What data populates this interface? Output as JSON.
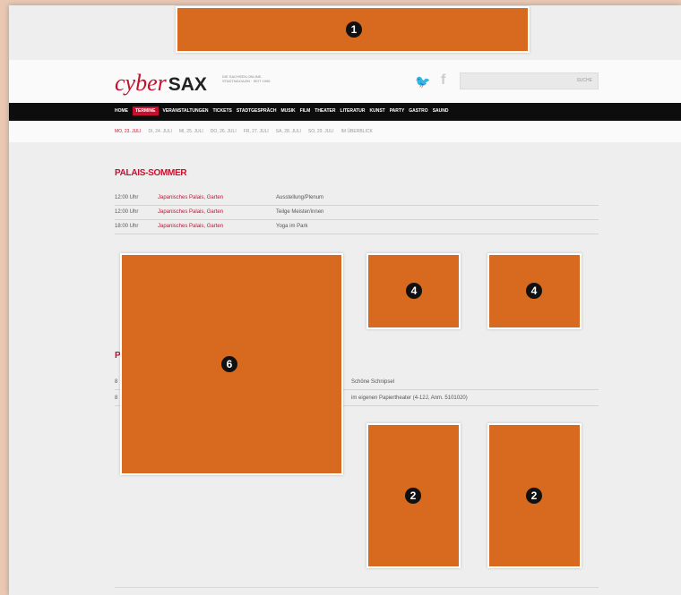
{
  "header": {
    "logo_script": "cyber",
    "logo_bold": "SAX",
    "tagline": "DIE SACHSEN-ONLINE-STADTMAGAZIN · SEIT 1996",
    "social_twitter_icon": "twitter-icon",
    "social_facebook_icon": "facebook-icon",
    "search_placeholder": "",
    "search_button": "SUCHE"
  },
  "nav_main": {
    "items": [
      "HOME",
      "TERMINE",
      "VERANSTALTUNGEN",
      "TICKETS",
      "STADTGESPRÄCH",
      "MUSIK",
      "FILM",
      "THEATER",
      "LITERATUR",
      "KUNST",
      "PARTY",
      "GASTRO",
      "SAUND"
    ],
    "active_index": 1
  },
  "nav_sub": {
    "items": [
      "MO, 23. JULI",
      "DI, 24. JULI",
      "MI, 25. JULI",
      "DO, 26. JULI",
      "FR, 27. JULI",
      "SA, 28. JULI",
      "SO, 29. JULI",
      "IM ÜBERBLICK"
    ],
    "active_index": 0
  },
  "section1": {
    "title": "PALAIS-SOMMER",
    "events": [
      {
        "time": "12:00 Uhr",
        "venue": "Japanisches Palais, Garten",
        "event": "Ausstellung/Plenum"
      },
      {
        "time": "12:00 Uhr",
        "venue": "Japanisches Palais, Garten",
        "event": "Teilge Meister/innen"
      },
      {
        "time": "18:00 Uhr",
        "venue": "Japanisches Palais, Garten",
        "event": "Yoga im Park"
      }
    ]
  },
  "section2": {
    "title_fragment": "P",
    "rows": [
      {
        "left": "",
        "right": "Schöne Schnipsel"
      },
      {
        "left": "",
        "right": "im eigenen Papiertheater (4-12J, Anm. 5101020)"
      }
    ],
    "row_prefix_letter": "8"
  },
  "annotations": {
    "badge_1": "1",
    "badge_2a": "2",
    "badge_2b": "2",
    "badge_4a": "4",
    "badge_4b": "4",
    "badge_6": "6"
  },
  "colors": {
    "accent_red": "#c8102e",
    "redaction_orange": "#d86a1f",
    "nav_black": "#0d0d0d"
  }
}
